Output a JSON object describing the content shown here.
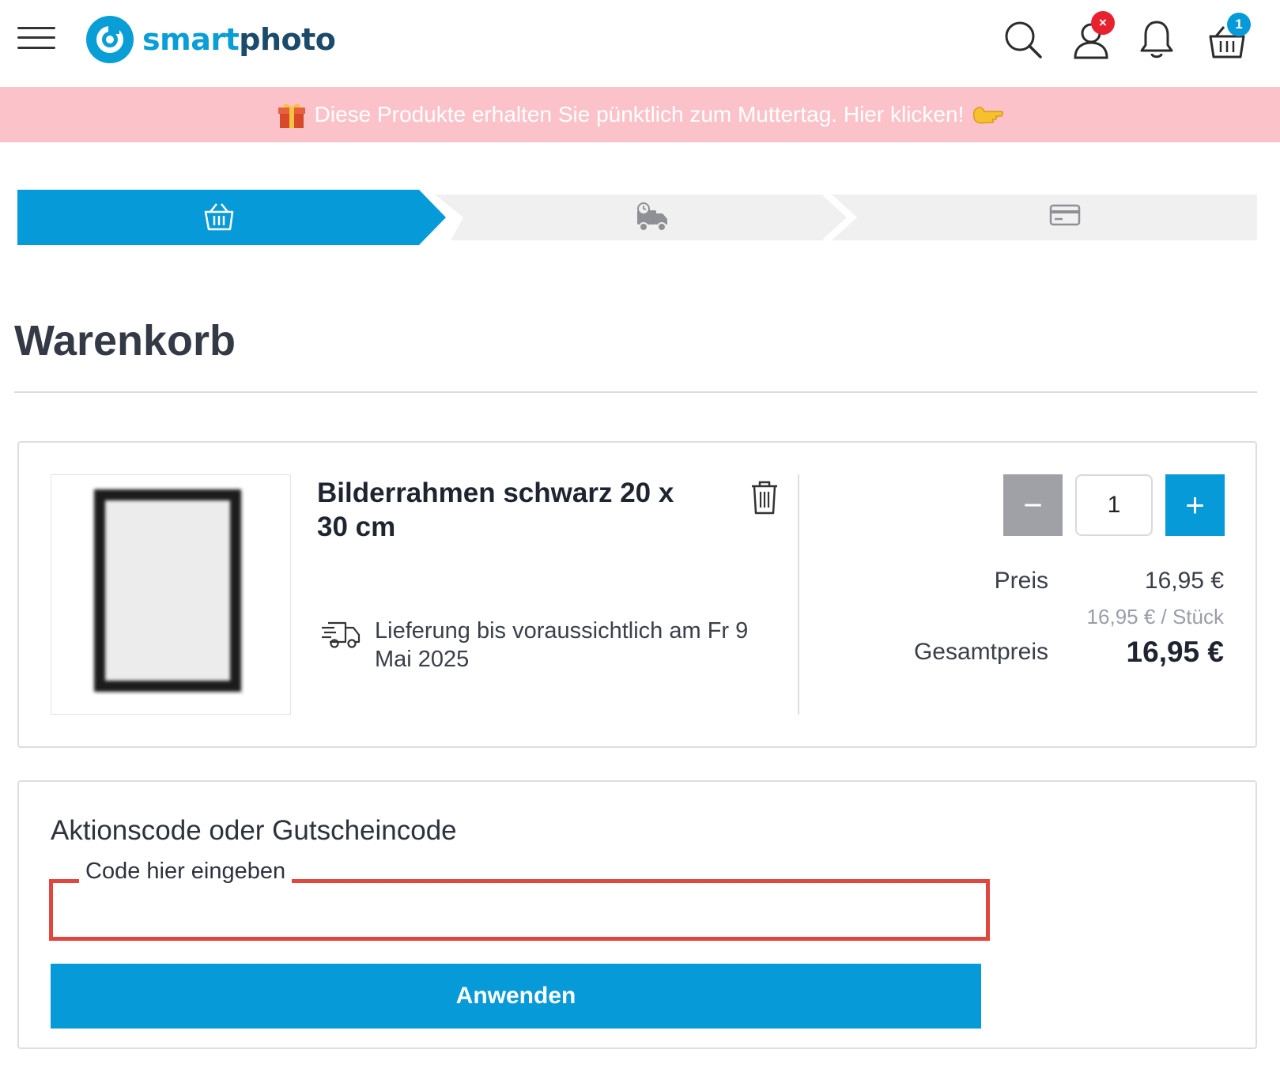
{
  "brand": {
    "logo_part1": "smart",
    "logo_part2": "photo"
  },
  "header": {
    "account_badge": "×",
    "cart_badge": "1"
  },
  "promo": {
    "text": "Diese Produkte erhalten Sie pünktlich zum Muttertag. Hier klicken!"
  },
  "steps": [
    {
      "icon": "basket-icon",
      "active": true
    },
    {
      "icon": "delivery-truck-icon",
      "active": false
    },
    {
      "icon": "credit-card-icon",
      "active": false
    }
  ],
  "page": {
    "title": "Warenkorb"
  },
  "cart_item": {
    "name": "Bilderrahmen schwarz 20 x 30 cm",
    "delivery": "Lieferung bis voraussichtlich am Fr 9 Mai 2025",
    "quantity": "1",
    "minus_label": "−",
    "plus_label": "+",
    "price_label": "Preis",
    "price": "16,95 €",
    "unit_price": "16,95 € / Stück",
    "total_label": "Gesamtpreis",
    "total": "16,95 €"
  },
  "coupon": {
    "title": "Aktionscode oder Gutscheincode",
    "field_label": "Code hier eingeben",
    "value": "",
    "button": "Anwenden"
  },
  "colors": {
    "primary": "#079ad8",
    "promo_bg": "#fbc3c9",
    "highlight": "#e2473f",
    "badge_red": "#e8212e"
  }
}
